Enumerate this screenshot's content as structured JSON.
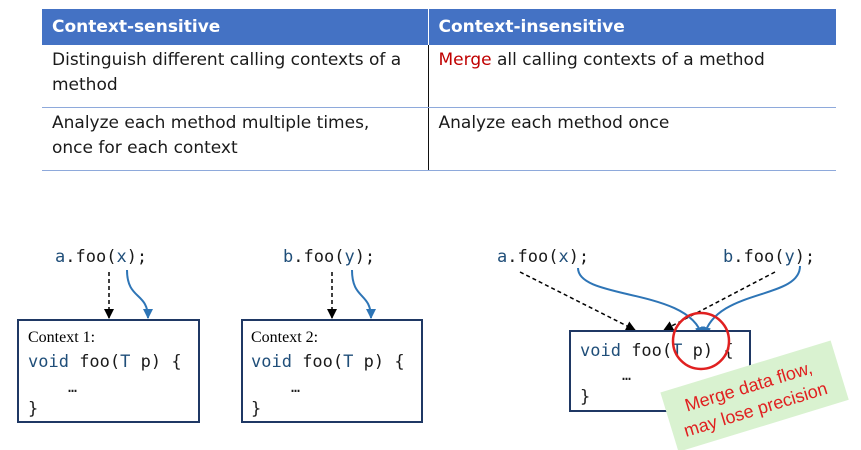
{
  "table": {
    "headers": [
      "Context-sensitive",
      "Context-insensitive"
    ],
    "rows": [
      {
        "left_line1": "Distinguish different calling contexts of a",
        "left_line2": "method",
        "right_highlight": "Merge",
        "right_rest": " all calling contexts of a method"
      },
      {
        "left_line1": "Analyze each method multiple times,",
        "left_line2": "once for each context",
        "right_text": "Analyze each method once"
      }
    ]
  },
  "diagram1": {
    "call_obj": "a",
    "call_method": ".foo(",
    "call_arg": "x",
    "call_end": ");",
    "context_label": "Context 1:",
    "sig_void": "void",
    "sig_name": " foo(",
    "sig_type": "T",
    "sig_param": " p",
    "sig_end": ") {",
    "ellipsis": "…",
    "close": "}"
  },
  "diagram2": {
    "call_obj": "b",
    "call_method": ".foo(",
    "call_arg": "y",
    "call_end": ");",
    "context_label": "Context 2:",
    "sig_void": "void",
    "sig_name": " foo(",
    "sig_type": "T",
    "sig_param": " p",
    "sig_end": ") {",
    "ellipsis": "…",
    "close": "}"
  },
  "diagram3": {
    "call_a_obj": "a",
    "call_a_method": ".foo(",
    "call_a_arg": "x",
    "call_a_end": ");",
    "call_b_obj": "b",
    "call_b_method": ".foo(",
    "call_b_arg": "y",
    "call_b_end": ");",
    "sig_void": "void",
    "sig_name": " foo(",
    "sig_type": "T",
    "sig_param": " p",
    "sig_end": ") {",
    "ellipsis": "…",
    "close": "}",
    "note_line1": "Merge data flow,",
    "note_line2": "may lose precision"
  },
  "colors": {
    "header_bg": "#4472c4",
    "accent_red": "#c00000",
    "arrow_blue": "#2e75b6",
    "box_border": "#1f3864",
    "code_blue": "#1f4e79",
    "note_bg": "#d9f2d0",
    "note_text": "#e02020"
  }
}
